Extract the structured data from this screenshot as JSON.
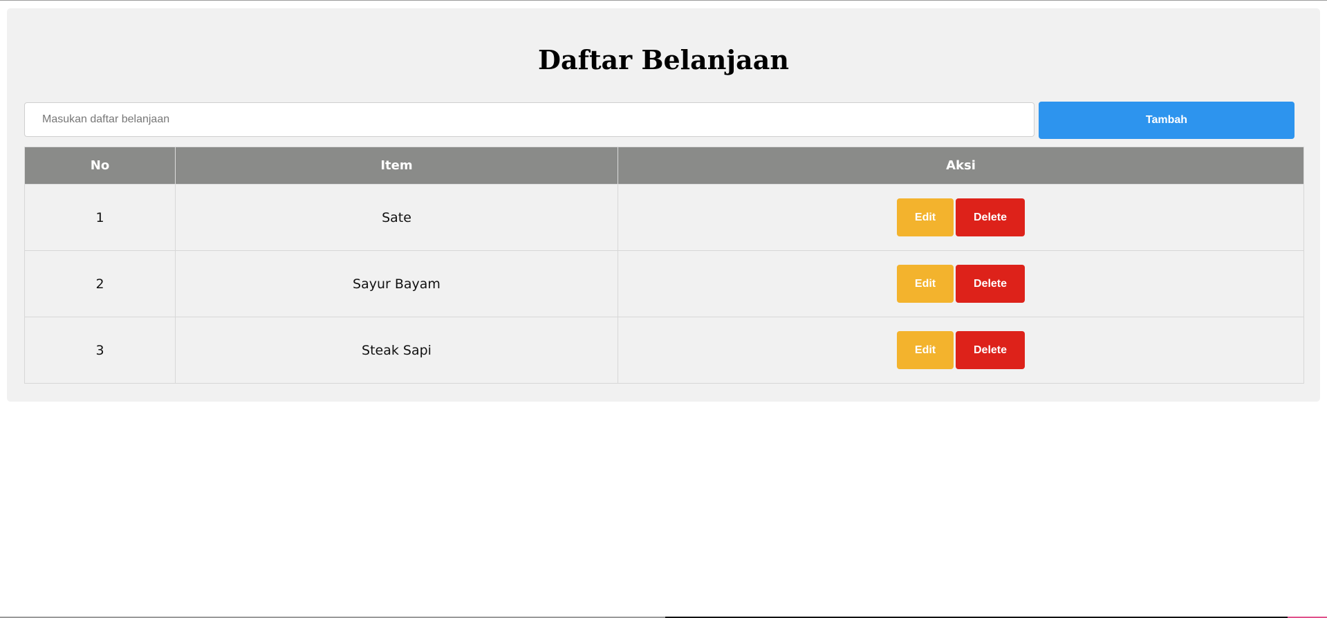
{
  "page": {
    "title": "Daftar Belanjaan"
  },
  "form": {
    "input_placeholder": "Masukan daftar belanjaan",
    "input_value": "",
    "add_button_label": "Tambah"
  },
  "table": {
    "headers": [
      "No",
      "Item",
      "Aksi"
    ],
    "rows": [
      {
        "no": "1",
        "item": "Sate",
        "edit_label": "Edit",
        "delete_label": "Delete"
      },
      {
        "no": "2",
        "item": "Sayur Bayam",
        "edit_label": "Edit",
        "delete_label": "Delete"
      },
      {
        "no": "3",
        "item": "Steak Sapi",
        "edit_label": "Edit",
        "delete_label": "Delete"
      }
    ]
  },
  "colors": {
    "card_background": "#f1f1f1",
    "header_background": "#8a8b89",
    "add_button": "#2d94ee",
    "edit_button": "#f3b32d",
    "delete_button": "#dd221a"
  }
}
